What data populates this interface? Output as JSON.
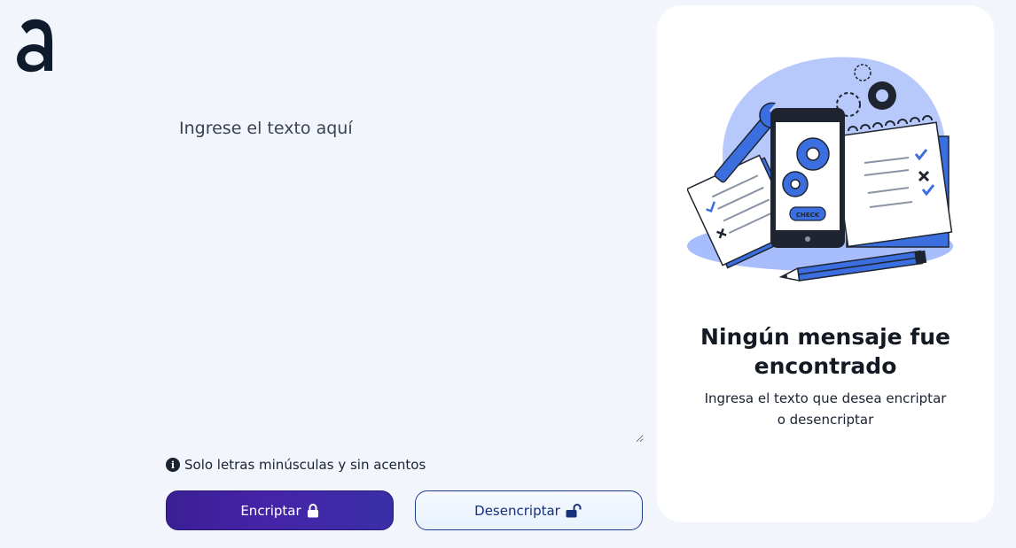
{
  "input": {
    "placeholder": "Ingrese el texto aquí",
    "value": ""
  },
  "hint": {
    "icon": "info-icon",
    "text": "Solo letras minúsculas y sin acentos"
  },
  "buttons": {
    "encrypt_label": "Encriptar",
    "encrypt_icon": "lock-icon",
    "decrypt_label": "Desencriptar",
    "decrypt_icon": "unlock-icon"
  },
  "panel": {
    "title": "Ningún mensaje fue encontrado",
    "subtitle": "Ingresa el texto que desea encriptar o desencriptar",
    "illustration": {
      "phone_button_label": "CHECK"
    }
  },
  "colors": {
    "background": "#f2f5fc",
    "primary": "#3b1f95",
    "accent_blue": "#3b6fe0",
    "dark": "#1b2230"
  }
}
